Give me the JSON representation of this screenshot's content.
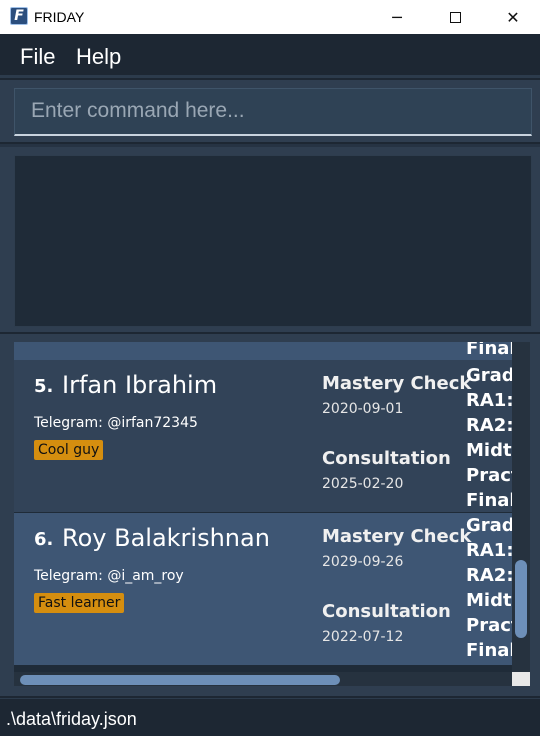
{
  "window": {
    "icon_letter": "F",
    "title": "FRIDAY",
    "minimize_glyph": "─",
    "close_glyph": "✕"
  },
  "menu": {
    "file": "File",
    "help": "Help"
  },
  "command": {
    "placeholder": "Enter command here..."
  },
  "result": {
    "text": ""
  },
  "students": [
    {
      "index": "5.",
      "name": "Irfan Ibrahim",
      "telegram": "Telegram: @irfan72345",
      "tag": "Cool guy",
      "mastery_label": "Mastery Check",
      "mastery_date": "2020-09-01",
      "consultation_label": "Consultation",
      "consultation_date": "2025-02-20",
      "grades_lines": [
        "Grade",
        "RA1:",
        "RA2:",
        "Midte",
        "Pract",
        "Finals"
      ]
    },
    {
      "index": "6.",
      "name": "Roy Balakrishnan",
      "telegram": "Telegram: @i_am_roy",
      "tag": "Fast learner",
      "mastery_label": "Mastery Check",
      "mastery_date": "2029-09-26",
      "consultation_label": "Consultation",
      "consultation_date": "2022-07-12",
      "grades_lines": [
        "Grade",
        "RA1:",
        "RA2:",
        "Midte",
        "Pract",
        "Finals"
      ]
    }
  ],
  "partial_top": {
    "grades_tail": "Finals"
  },
  "status": {
    "path": ".\\data\\friday.json"
  },
  "colors": {
    "background": "#1d2733",
    "card_dark": "#324358",
    "card_light": "#3e5674",
    "tag": "#d58e0f",
    "scroll_thumb": "#6d8fb8"
  }
}
